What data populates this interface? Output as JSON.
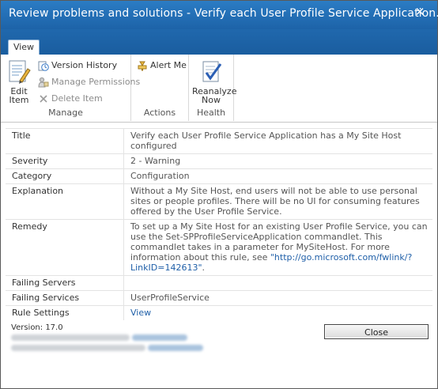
{
  "window": {
    "title": "Review problems and solutions - Verify each User Profile Service Application...",
    "close_glyph": "✕"
  },
  "ribbon": {
    "tab_label": "View",
    "groups": {
      "manage": {
        "label": "Manage",
        "edit_item": [
          "Edit",
          "Item"
        ],
        "version_history": "Version History",
        "manage_permissions": "Manage Permissions",
        "delete_item": "Delete Item"
      },
      "actions": {
        "label": "Actions",
        "alert_me": "Alert Me"
      },
      "health": {
        "label": "Health",
        "reanalyze": [
          "Reanalyze",
          "Now"
        ]
      }
    }
  },
  "properties": [
    {
      "key": "Title",
      "value": "Verify each User Profile Service Application has a My Site Host configured"
    },
    {
      "key": "Severity",
      "value": "2 - Warning"
    },
    {
      "key": "Category",
      "value": "Configuration"
    },
    {
      "key": "Explanation",
      "value": "Without a My Site Host, end users will not be able to use personal sites or people profiles. There will be no UI for consuming features offered by the User Profile Service."
    },
    {
      "key": "Remedy",
      "value": "To set up a My Site Host for an existing User Profile Service, you can use the Set-SPProfileServiceApplication commandlet. This commandlet takes in a parameter for MySiteHost. For more information about this rule, see ",
      "link": "\"http://go.microsoft.com/fwlink/?LinkID=142613\"",
      "suffix": "."
    },
    {
      "key": "Failing Servers",
      "value": ""
    },
    {
      "key": "Failing Services",
      "value": "UserProfileService"
    },
    {
      "key": "Rule Settings",
      "value": "View"
    }
  ],
  "footer": {
    "version": "Version: 17.0",
    "close_label": "Close"
  },
  "icons": {
    "edit": "edit-item-icon",
    "history": "version-history-icon",
    "permissions": "manage-permissions-icon",
    "delete": "delete-icon",
    "alert": "alert-me-icon",
    "reanalyze": "reanalyze-icon"
  },
  "colors": {
    "titlebar": "#1d63a8",
    "link": "#1f5fa8"
  }
}
